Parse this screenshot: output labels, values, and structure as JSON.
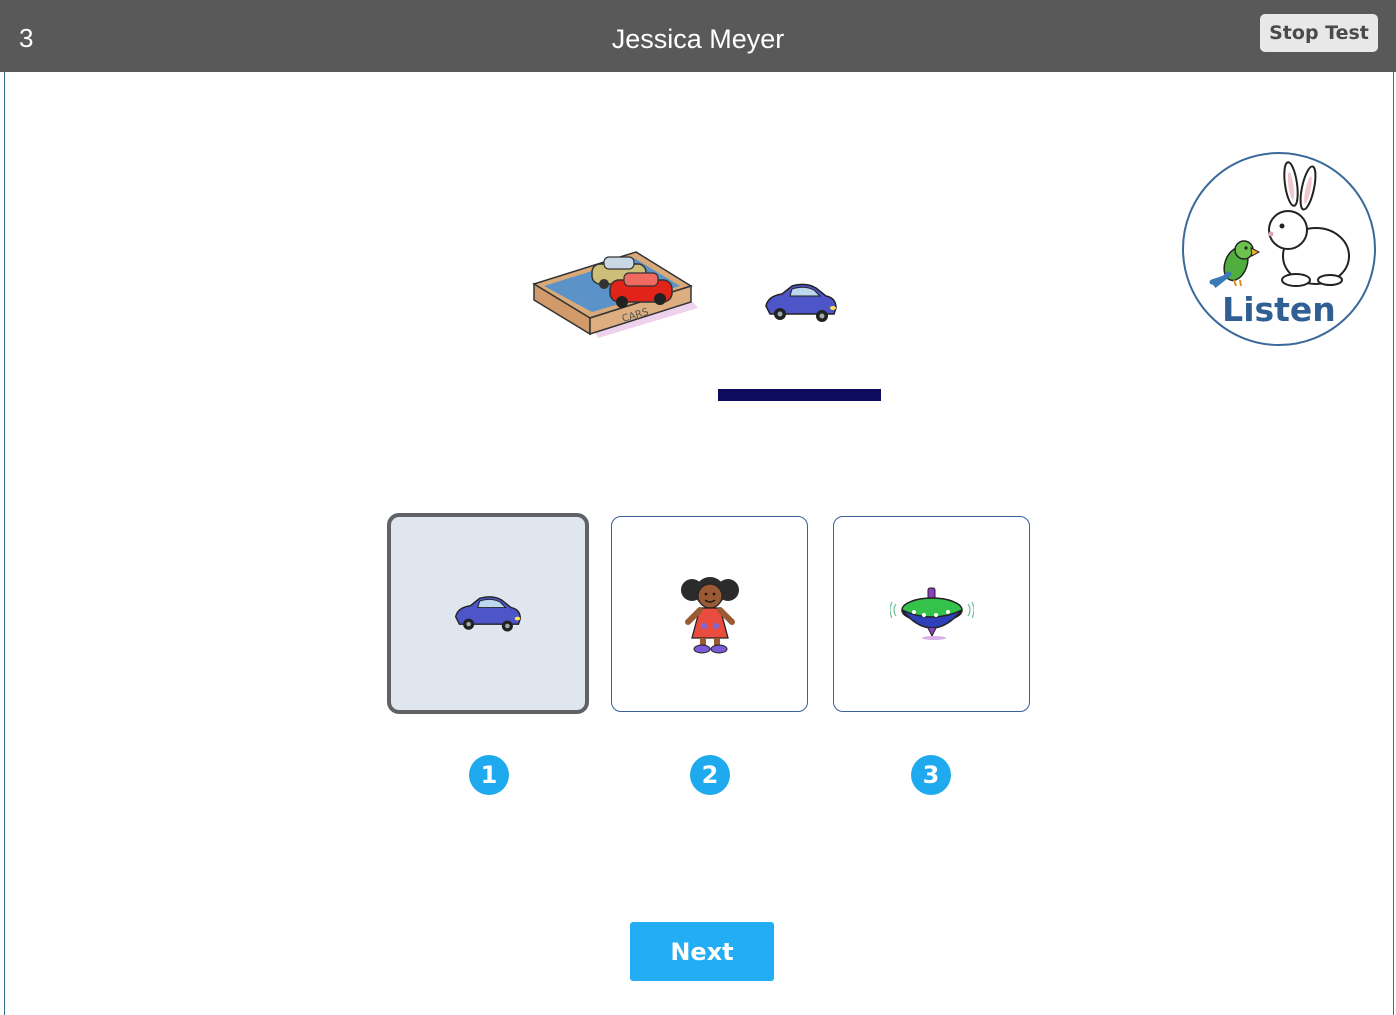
{
  "header": {
    "item_number": "3",
    "student_name": "Jessica Meyer",
    "stop_label": "Stop Test"
  },
  "listen": {
    "label": "Listen",
    "icons": [
      "rabbit-icon",
      "parrot-icon"
    ]
  },
  "prompt": {
    "images": [
      "toy-cars-box-image",
      "blue-car-image"
    ],
    "box_text": "CARS",
    "blank": "answer-blank"
  },
  "choices": [
    {
      "number": "1",
      "image": "blue-car-image",
      "selected": true
    },
    {
      "number": "2",
      "image": "doll-image",
      "selected": false
    },
    {
      "number": "3",
      "image": "spinning-top-image",
      "selected": false
    }
  ],
  "footer": {
    "next_label": "Next"
  },
  "colors": {
    "header_bg": "#595959",
    "accent": "#23adf4",
    "listen_text": "#2f5f93",
    "blank": "#0d0b5c",
    "selected_bg": "#dfe6ee"
  }
}
